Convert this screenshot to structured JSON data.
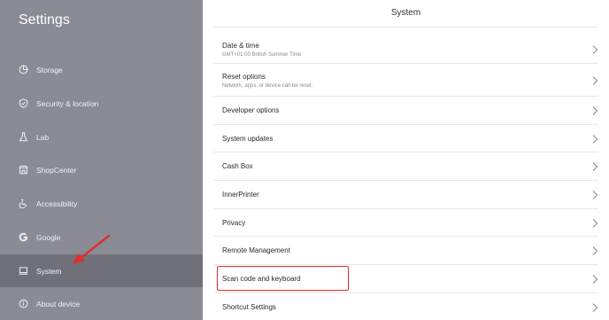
{
  "sidebar": {
    "title": "Settings",
    "items": [
      {
        "label": "Storage",
        "icon": "storage-icon",
        "selected": false
      },
      {
        "label": "Security & location",
        "icon": "shield-icon",
        "selected": false
      },
      {
        "label": "Lab",
        "icon": "flask-icon",
        "selected": false
      },
      {
        "label": "ShopCenter",
        "icon": "shop-icon",
        "selected": false
      },
      {
        "label": "Accessibility",
        "icon": "accessibility-icon",
        "selected": false
      },
      {
        "label": "Google",
        "icon": "google-icon",
        "selected": false
      },
      {
        "label": "System",
        "icon": "laptop-icon",
        "selected": true
      },
      {
        "label": "About device",
        "icon": "info-icon",
        "selected": false
      }
    ]
  },
  "main": {
    "title": "System",
    "rows": [
      {
        "label": "Date & time",
        "subtitle": "GMT+01:00 British Summer Time"
      },
      {
        "label": "Reset options",
        "subtitle": "Network, apps, or device can be reset."
      },
      {
        "label": "Developer options"
      },
      {
        "label": "System updates"
      },
      {
        "label": "Cash Box"
      },
      {
        "label": "InnerPrinter"
      },
      {
        "label": "Privacy"
      },
      {
        "label": "Remote Management"
      },
      {
        "label": "Scan code and keyboard",
        "highlighted": true
      },
      {
        "label": "Shortcut Settings"
      }
    ]
  },
  "annotation": {
    "highlight_color": "#e0302a"
  }
}
